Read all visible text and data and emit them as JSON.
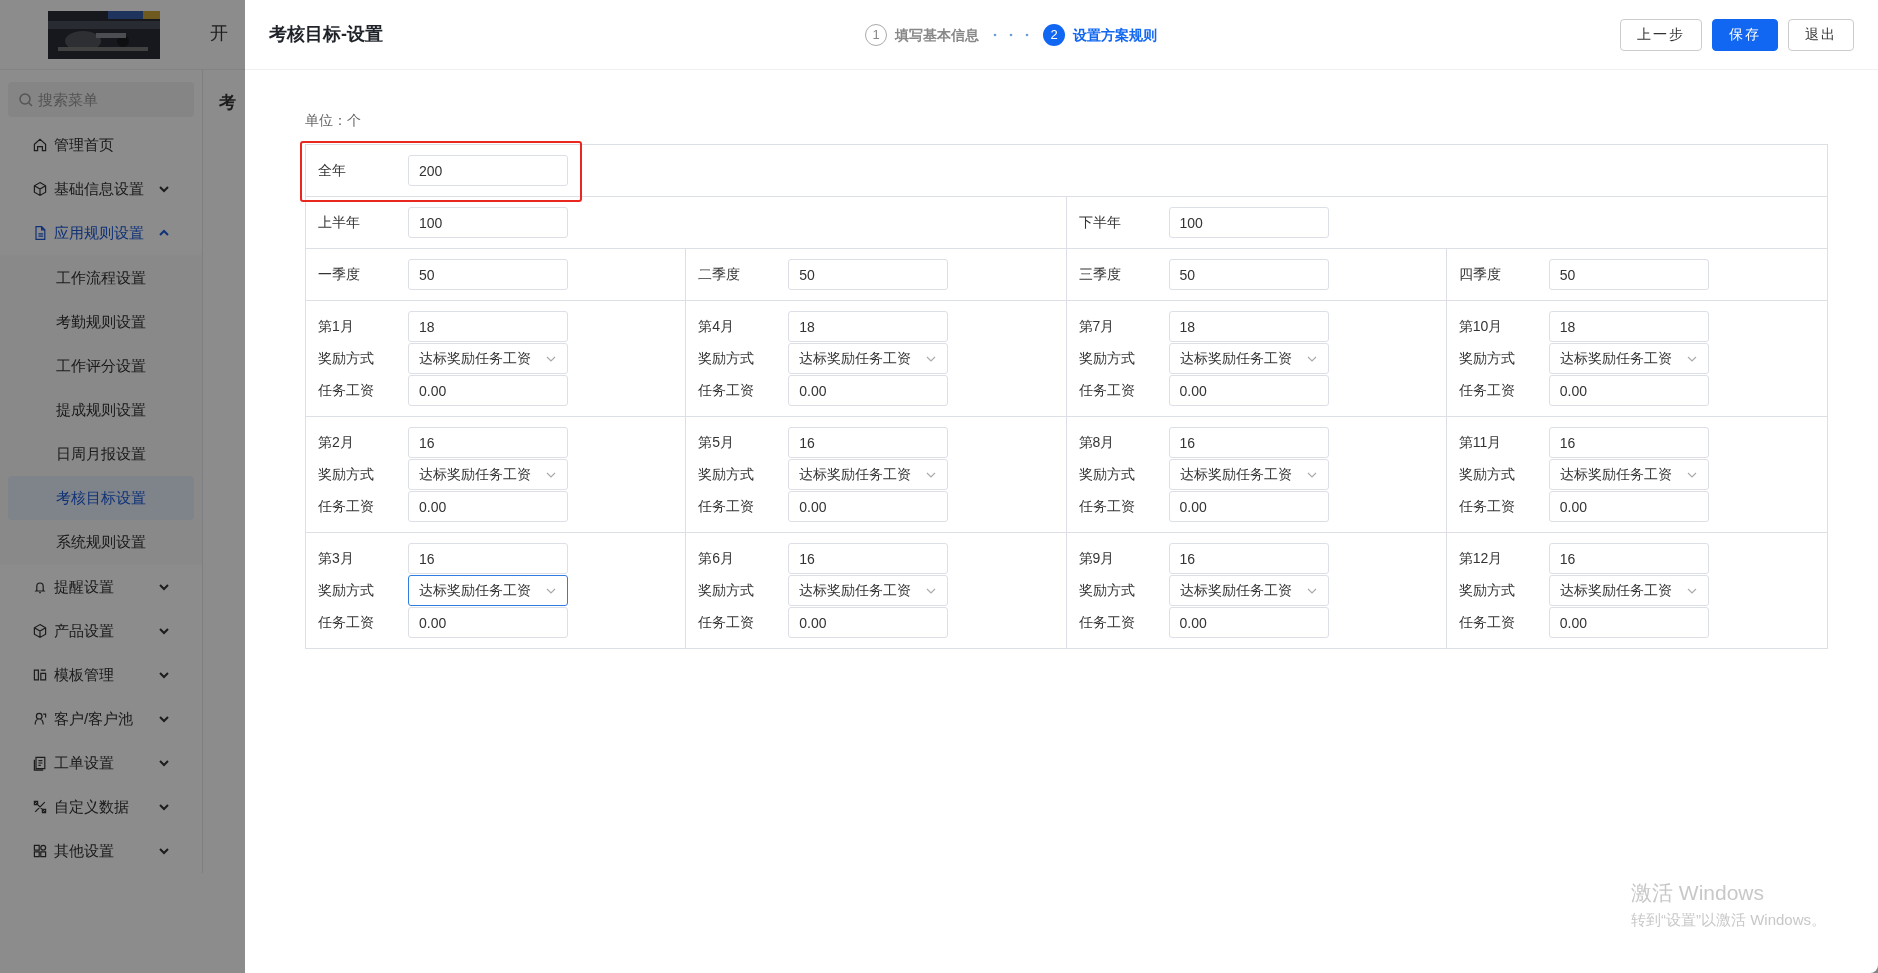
{
  "sidebar": {
    "search": {
      "placeholder": "搜索菜单"
    },
    "items": [
      {
        "label": "管理首页",
        "selected": false
      },
      {
        "label": "基础信息设置",
        "selected": false,
        "expanded": false
      },
      {
        "label": "应用规则设置",
        "selected": true,
        "expanded": true,
        "children": [
          {
            "label": "工作流程设置",
            "selected": false
          },
          {
            "label": "考勤规则设置",
            "selected": false
          },
          {
            "label": "工作评分设置",
            "selected": false
          },
          {
            "label": "提成规则设置",
            "selected": false
          },
          {
            "label": "日周月报设置",
            "selected": false
          },
          {
            "label": "考核目标设置",
            "selected": true
          },
          {
            "label": "系统规则设置",
            "selected": false
          }
        ]
      },
      {
        "label": "提醒设置",
        "selected": false,
        "expanded": false
      },
      {
        "label": "产品设置",
        "selected": false,
        "expanded": false
      },
      {
        "label": "模板管理",
        "selected": false,
        "expanded": false
      },
      {
        "label": "客户/客户池",
        "selected": false,
        "expanded": false
      },
      {
        "label": "工单设置",
        "selected": false,
        "expanded": false
      },
      {
        "label": "自定义数据",
        "selected": false,
        "expanded": false
      },
      {
        "label": "其他设置",
        "selected": false,
        "expanded": false
      }
    ]
  },
  "background": {
    "header_text": "开",
    "page_title": "考"
  },
  "drawer": {
    "title": "考核目标-设置",
    "steps": [
      {
        "number": "1",
        "label": "填写基本信息",
        "selected": false
      },
      {
        "number": "2",
        "label": "设置方案规则",
        "selected": true
      }
    ],
    "buttons": [
      {
        "label": "上一步",
        "kind": "default"
      },
      {
        "label": "保存",
        "kind": "primary"
      },
      {
        "label": "退出",
        "kind": "default"
      }
    ],
    "unit": "单位：个",
    "rows": [
      {
        "kind": "quarter",
        "highlighted": true,
        "cells": [
          {
            "fields": [
              {
                "label": "全年",
                "kind": "input",
                "value": "200",
                "focused": false
              }
            ]
          },
          "",
          "",
          ""
        ]
      },
      {
        "kind": "quarter",
        "highlighted": false,
        "cells": [
          {
            "fields": [
              {
                "label": "上半年",
                "kind": "input",
                "value": "100",
                "focused": false
              }
            ]
          },
          "",
          {
            "fields": [
              {
                "label": "下半年",
                "kind": "input",
                "value": "100",
                "focused": false
              }
            ]
          },
          ""
        ]
      },
      {
        "kind": "quarter",
        "highlighted": false,
        "cells": [
          {
            "fields": [
              {
                "label": "一季度",
                "kind": "input",
                "value": "50",
                "focused": false
              }
            ]
          },
          {
            "fields": [
              {
                "label": "二季度",
                "kind": "input",
                "value": "50",
                "focused": false
              }
            ]
          },
          {
            "fields": [
              {
                "label": "三季度",
                "kind": "input",
                "value": "50",
                "focused": false
              }
            ]
          },
          {
            "fields": [
              {
                "label": "四季度",
                "kind": "input",
                "value": "50",
                "focused": false
              }
            ]
          }
        ]
      },
      {
        "kind": "quarter",
        "highlighted": false,
        "cells": [
          {
            "fields": [
              {
                "label": "第1月",
                "kind": "input",
                "value": "18",
                "focused": false
              },
              {
                "label": "奖励方式",
                "kind": "select",
                "value": "达标奖励任务工资",
                "focused": false
              },
              {
                "label": "任务工资",
                "kind": "input",
                "value": "0.00",
                "focused": false
              }
            ]
          },
          {
            "fields": [
              {
                "label": "第4月",
                "kind": "input",
                "value": "18",
                "focused": false
              },
              {
                "label": "奖励方式",
                "kind": "select",
                "value": "达标奖励任务工资",
                "focused": false
              },
              {
                "label": "任务工资",
                "kind": "input",
                "value": "0.00",
                "focused": false
              }
            ]
          },
          {
            "fields": [
              {
                "label": "第7月",
                "kind": "input",
                "value": "18",
                "focused": false
              },
              {
                "label": "奖励方式",
                "kind": "select",
                "value": "达标奖励任务工资",
                "focused": false
              },
              {
                "label": "任务工资",
                "kind": "input",
                "value": "0.00",
                "focused": false
              }
            ]
          },
          {
            "fields": [
              {
                "label": "第10月",
                "kind": "input",
                "value": "18",
                "focused": false
              },
              {
                "label": "奖励方式",
                "kind": "select",
                "value": "达标奖励任务工资",
                "focused": false
              },
              {
                "label": "任务工资",
                "kind": "input",
                "value": "0.00",
                "focused": false
              }
            ]
          }
        ]
      },
      {
        "kind": "quarter",
        "highlighted": false,
        "cells": [
          {
            "fields": [
              {
                "label": "第2月",
                "kind": "input",
                "value": "16",
                "focused": false
              },
              {
                "label": "奖励方式",
                "kind": "select",
                "value": "达标奖励任务工资",
                "focused": false
              },
              {
                "label": "任务工资",
                "kind": "input",
                "value": "0.00",
                "focused": false
              }
            ]
          },
          {
            "fields": [
              {
                "label": "第5月",
                "kind": "input",
                "value": "16",
                "focused": false
              },
              {
                "label": "奖励方式",
                "kind": "select",
                "value": "达标奖励任务工资",
                "focused": false
              },
              {
                "label": "任务工资",
                "kind": "input",
                "value": "0.00",
                "focused": false
              }
            ]
          },
          {
            "fields": [
              {
                "label": "第8月",
                "kind": "input",
                "value": "16",
                "focused": false
              },
              {
                "label": "奖励方式",
                "kind": "select",
                "value": "达标奖励任务工资",
                "focused": false
              },
              {
                "label": "任务工资",
                "kind": "input",
                "value": "0.00",
                "focused": false
              }
            ]
          },
          {
            "fields": [
              {
                "label": "第11月",
                "kind": "input",
                "value": "16",
                "focused": false
              },
              {
                "label": "奖励方式",
                "kind": "select",
                "value": "达标奖励任务工资",
                "focused": false
              },
              {
                "label": "任务工资",
                "kind": "input",
                "value": "0.00",
                "focused": false
              }
            ]
          }
        ]
      },
      {
        "kind": "quarter",
        "highlighted": false,
        "cells": [
          {
            "fields": [
              {
                "label": "第3月",
                "kind": "input",
                "value": "16",
                "focused": false
              },
              {
                "label": "奖励方式",
                "kind": "select",
                "value": "达标奖励任务工资",
                "focused": true
              },
              {
                "label": "任务工资",
                "kind": "input",
                "value": "0.00",
                "focused": false
              }
            ]
          },
          {
            "fields": [
              {
                "label": "第6月",
                "kind": "input",
                "value": "16",
                "focused": false
              },
              {
                "label": "奖励方式",
                "kind": "select",
                "value": "达标奖励任务工资",
                "focused": false
              },
              {
                "label": "任务工资",
                "kind": "input",
                "value": "0.00",
                "focused": false
              }
            ]
          },
          {
            "fields": [
              {
                "label": "第9月",
                "kind": "input",
                "value": "16",
                "focused": false
              },
              {
                "label": "奖励方式",
                "kind": "select",
                "value": "达标奖励任务工资",
                "focused": false
              },
              {
                "label": "任务工资",
                "kind": "input",
                "value": "0.00",
                "focused": false
              }
            ]
          },
          {
            "fields": [
              {
                "label": "第12月",
                "kind": "input",
                "value": "16",
                "focused": false
              },
              {
                "label": "奖励方式",
                "kind": "select",
                "value": "达标奖励任务工资",
                "focused": false
              },
              {
                "label": "任务工资",
                "kind": "input",
                "value": "0.00",
                "focused": false
              }
            ]
          }
        ]
      }
    ]
  },
  "os_notice": {
    "title": "激活 Windows",
    "subtitle": "转到“设置”以激活 Windows。"
  }
}
